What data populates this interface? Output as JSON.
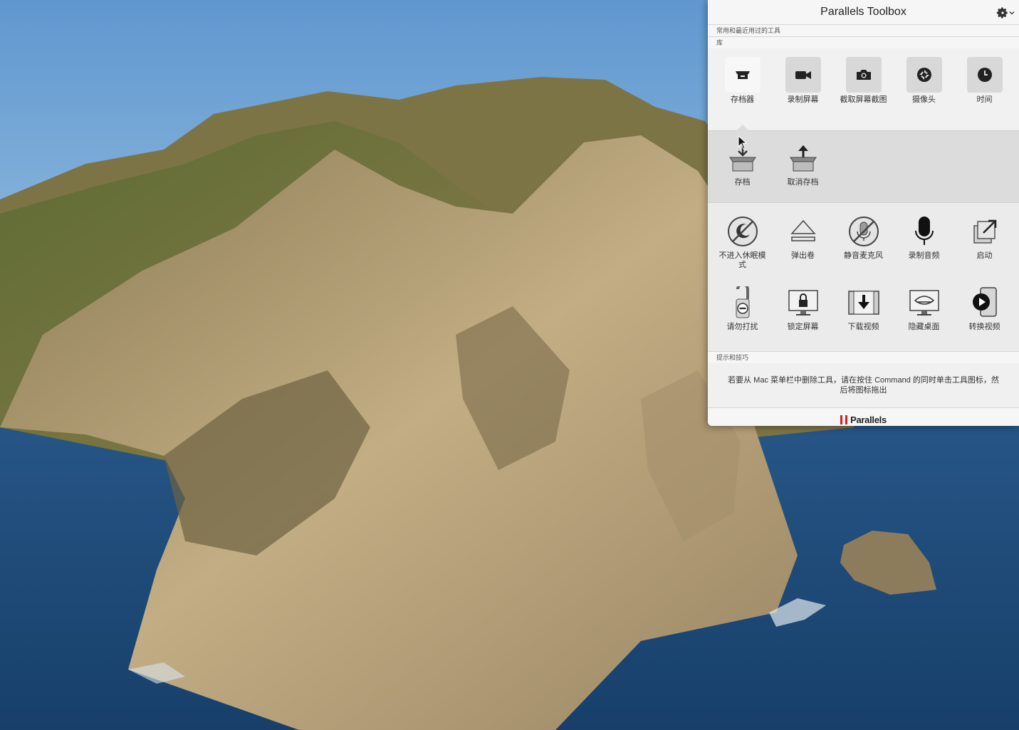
{
  "window": {
    "title": "Parallels Toolbox",
    "settings_icon": "gear-icon"
  },
  "sections": {
    "recent_label": "常用和最近用过的工具",
    "library_label": "库",
    "tips_label": "提示和技巧"
  },
  "recent_tools": [
    {
      "label": "存档器",
      "icon": "archiver-icon",
      "active": true
    },
    {
      "label": "录制屏幕",
      "icon": "video-camera-icon"
    },
    {
      "label": "截取屏幕截图",
      "icon": "camera-icon"
    },
    {
      "label": "摄像头",
      "icon": "webcam-icon"
    },
    {
      "label": "时间",
      "icon": "clock-icon"
    }
  ],
  "archiver_subtools": [
    {
      "label": "存档",
      "icon": "archive-box-down-icon"
    },
    {
      "label": "取消存档",
      "icon": "archive-box-up-icon"
    }
  ],
  "library_tools": [
    {
      "label": "不进入休眠模式",
      "label_line2": "式",
      "label_line1": "不进入休眠模",
      "icon": "no-sleep-icon"
    },
    {
      "label": "弹出卷",
      "icon": "eject-icon"
    },
    {
      "label": "静音麦克风",
      "icon": "mute-microphone-icon"
    },
    {
      "label": "录制音频",
      "icon": "microphone-icon"
    },
    {
      "label": "启动",
      "icon": "launch-icon"
    },
    {
      "label": "请勿打扰",
      "icon": "do-not-disturb-icon"
    },
    {
      "label": "锁定屏幕",
      "icon": "lock-screen-icon"
    },
    {
      "label": "下载视频",
      "icon": "download-video-icon"
    },
    {
      "label": "隐藏桌面",
      "icon": "hide-desktop-icon"
    },
    {
      "label": "转换视频",
      "icon": "convert-video-icon"
    }
  ],
  "tip": {
    "line1": "若要从 Mac 菜单栏中删除工具，请在按住 Command 的同时单击工具图标，然",
    "line2": "后将图标拖出"
  },
  "footer": {
    "brand": "Parallels"
  },
  "colors": {
    "brand_red": "#d0211c",
    "sky": "#7fb2dc",
    "sea": "#1f4a78"
  }
}
